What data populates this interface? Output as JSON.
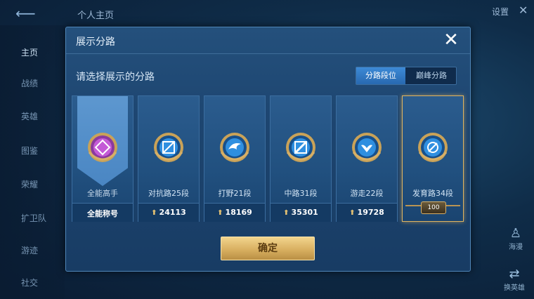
{
  "background": {
    "page_title": "个人主页",
    "settings_label": "设置",
    "close_glyph": "✕",
    "sidebar": [
      {
        "label": "主页",
        "active": true
      },
      {
        "label": "战绩",
        "active": false
      },
      {
        "label": "英雄",
        "active": false
      },
      {
        "label": "图鉴",
        "active": false
      },
      {
        "label": "荣耀",
        "active": false
      },
      {
        "label": "扩卫队",
        "active": false
      },
      {
        "label": "游迹",
        "active": false
      },
      {
        "label": "社交",
        "active": false
      }
    ],
    "right_icons": [
      {
        "label": "海漫",
        "icon": "person-icon"
      },
      {
        "label": "换英雄",
        "icon": "swap-icon"
      }
    ]
  },
  "modal": {
    "title": "展示分路",
    "close_glyph": "✕",
    "subtitle": "请选择展示的分路",
    "tabs": [
      {
        "label": "分路段位",
        "active": true
      },
      {
        "label": "巅峰分路",
        "active": false
      }
    ],
    "cards": [
      {
        "name": "全能高手",
        "stat": "全能称号",
        "icon": "allround-emblem-icon",
        "emblem_color": "#b94fc8",
        "selected": false,
        "featured": true
      },
      {
        "name": "对抗路25段",
        "stat": "24113",
        "icon": "clash-lane-emblem-icon",
        "emblem_color": "#2f8fe0",
        "selected": false
      },
      {
        "name": "打野21段",
        "stat": "18169",
        "icon": "jungle-emblem-icon",
        "emblem_color": "#2f8fe0",
        "selected": false
      },
      {
        "name": "中路31段",
        "stat": "35301",
        "icon": "mid-lane-emblem-icon",
        "emblem_color": "#2f8fe0",
        "selected": false
      },
      {
        "name": "游走22段",
        "stat": "19728",
        "icon": "roam-emblem-icon",
        "emblem_color": "#2f8fe0",
        "selected": false
      },
      {
        "name": "发育路34段",
        "badge": "100",
        "icon": "farm-lane-emblem-icon",
        "emblem_color": "#2f8fe0",
        "selected": true
      }
    ],
    "confirm_label": "确定"
  },
  "colors": {
    "accent_gold": "#e0b45f",
    "tab_active": "#2f7dc6"
  }
}
